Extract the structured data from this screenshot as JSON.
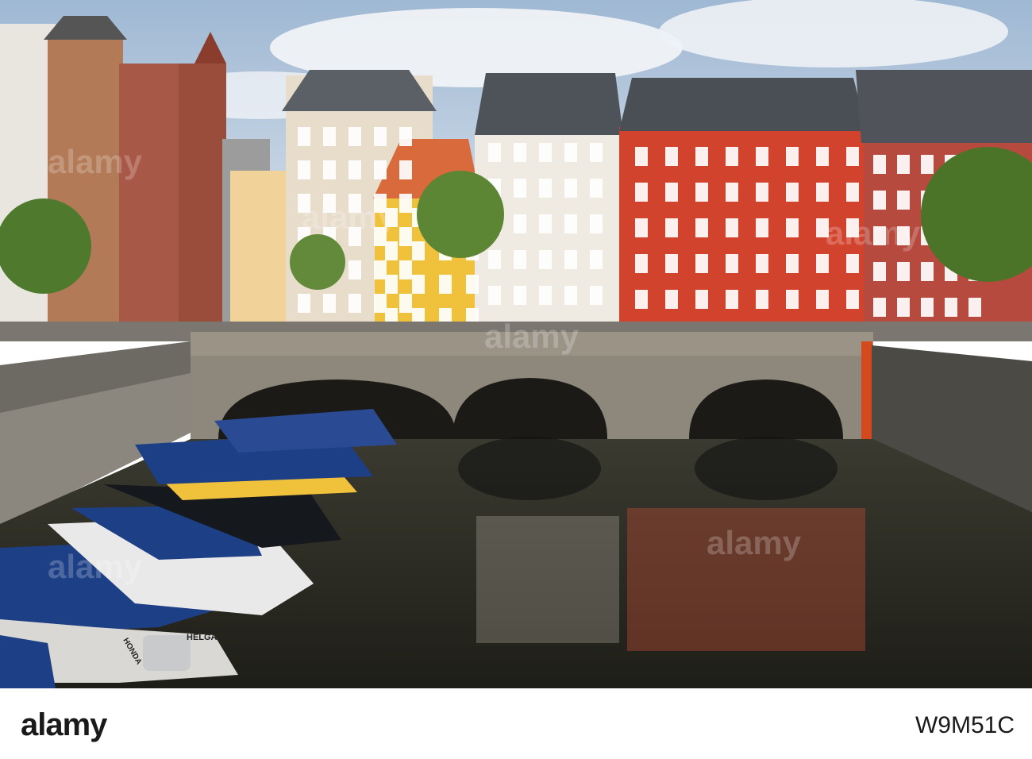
{
  "photo": {
    "scene": "canal-bridge-townhouses",
    "colors": {
      "sky": "#c8d7e6",
      "water": "#2b2a22",
      "red_facade": "#d2432d",
      "yellow_facade": "#f0c23c",
      "boat_cover": "#1d3f86",
      "bridge_stone": "#8e877b"
    },
    "boat_label": "HELGA",
    "outboard_brand": "HONDA"
  },
  "footer": {
    "logo_text": "alamy",
    "image_id": "W9M51C"
  },
  "watermarks": [
    "alamy",
    "alamy",
    "alamy",
    "alamy",
    "alamy",
    "alamy"
  ]
}
